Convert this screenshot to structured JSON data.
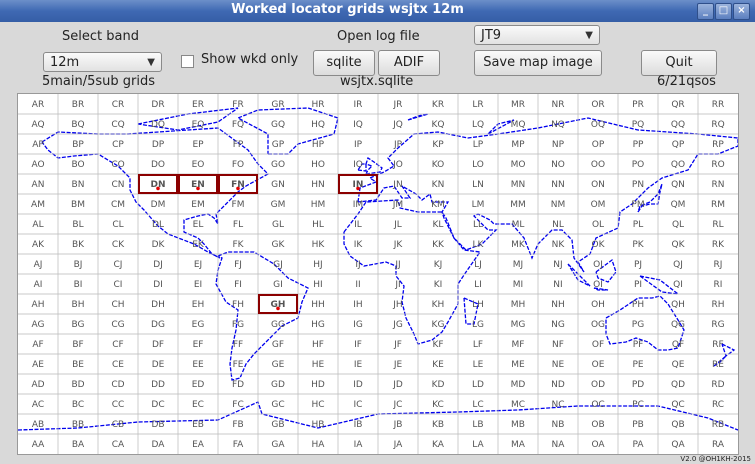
{
  "window": {
    "title": "Worked locator grids wsjtx 12m",
    "btn_min": "_",
    "btn_max": "□",
    "btn_close": "×"
  },
  "controls": {
    "select_band_label": "Select band",
    "band_value": "12m",
    "show_wkd_label": "Show wkd only",
    "open_log_label": "Open log file",
    "sqlite_button": "sqlite",
    "adif_button": "ADIF",
    "mode_value": "JT9",
    "save_map_button": "Save map image",
    "quit_button": "Quit",
    "grid_stats": "5main/5sub grids",
    "log_file": "wsjtx.sqlite",
    "qso_stats": "6/21qsos"
  },
  "map": {
    "columns": [
      "A",
      "B",
      "C",
      "D",
      "E",
      "F",
      "G",
      "H",
      "I",
      "J",
      "K",
      "L",
      "M",
      "N",
      "O",
      "P",
      "Q",
      "R"
    ],
    "rows": [
      "R",
      "Q",
      "P",
      "O",
      "N",
      "M",
      "L",
      "K",
      "J",
      "I",
      "H",
      "G",
      "F",
      "E",
      "D",
      "C",
      "B",
      "A"
    ],
    "worked": [
      "DN",
      "EN",
      "FN",
      "IN",
      "GH"
    ],
    "coast_color": "#0000ee",
    "worked_color": "#8b0000",
    "grid_color": "#b8b8b8",
    "label_color": "#555555"
  },
  "version": "V2.0 @OH1KH-2015"
}
